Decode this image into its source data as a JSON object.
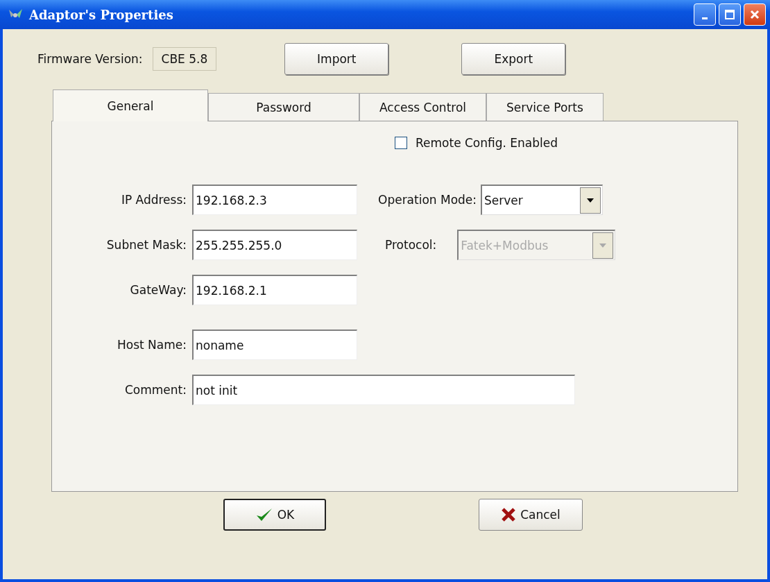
{
  "window": {
    "title": "Adaptor's Properties"
  },
  "firmware": {
    "label": "Firmware Version:",
    "value": "CBE 5.8"
  },
  "top_buttons": [
    "Import",
    "Export"
  ],
  "tabs": [
    {
      "label": "General",
      "selected": true
    },
    {
      "label": "Password",
      "selected": false
    },
    {
      "label": "Access Control",
      "selected": false
    },
    {
      "label": "Service Ports",
      "selected": false
    }
  ],
  "remote_config": {
    "label": "Remote Config. Enabled",
    "checked": false
  },
  "left_fields": [
    {
      "label": "IP Address:",
      "value": "192.168.2.3"
    },
    {
      "label": "Subnet Mask:",
      "value": "255.255.255.0"
    },
    {
      "label": "GateWay:",
      "value": "192.168.2.1"
    },
    {
      "label": "Host Name:",
      "value": "noname"
    },
    {
      "label": "Comment:",
      "value": "not init",
      "wide": true
    }
  ],
  "right_fields": [
    {
      "label": "Operation Mode:",
      "value": "Server",
      "disabled": false
    },
    {
      "label": "Protocol:",
      "value": "Fatek+Modbus",
      "disabled": true
    }
  ],
  "buttons": [
    {
      "label": "OK",
      "kind": "ok"
    },
    {
      "label": "Cancel",
      "kind": "cancel"
    }
  ]
}
